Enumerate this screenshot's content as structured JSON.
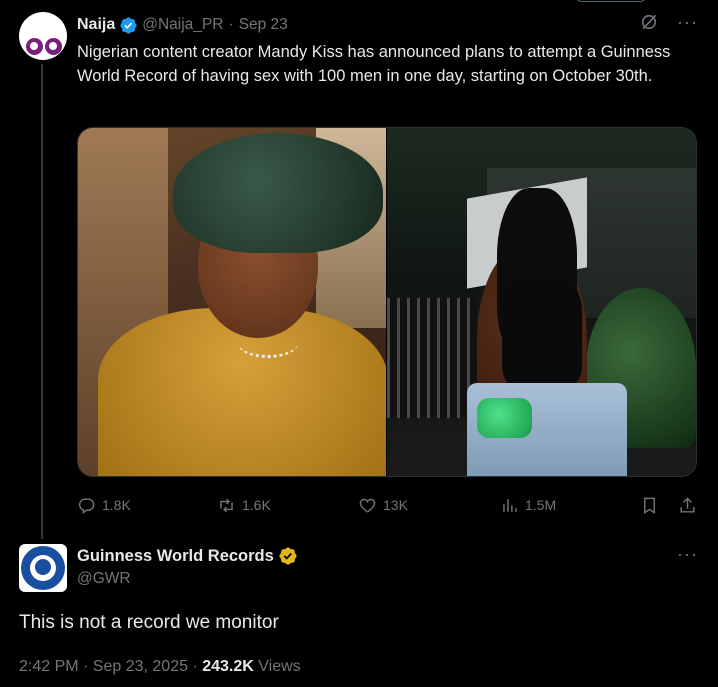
{
  "parent": {
    "name": "Naija",
    "handle": "@Naija_PR",
    "separator": "·",
    "date": "Sep 23",
    "more": "···",
    "text": "Nigerian content creator Mandy Kiss has announced plans to attempt a Guinness World Record of having sex with 100 men in one day, starting on October 30th.",
    "actions": {
      "replies": "1.8K",
      "reposts": "1.6K",
      "likes": "13K",
      "views": "1.5M"
    }
  },
  "reply": {
    "name": "Guinness World Records",
    "handle": "@GWR",
    "more": "···",
    "text": "This is not a record we monitor",
    "time": "2:42 PM · Sep 23, 2025 · ",
    "views_count": "243.2K",
    "views_label": " Views",
    "avatar_text": "GUINNESS WORLD RECORDS"
  },
  "colors": {
    "background": "#000000",
    "text_primary": "#e7e9ea",
    "text_secondary": "#71767b",
    "verified_blue": "#1d9bf0",
    "verified_gold": "#e2b719",
    "border": "#2f3336"
  }
}
